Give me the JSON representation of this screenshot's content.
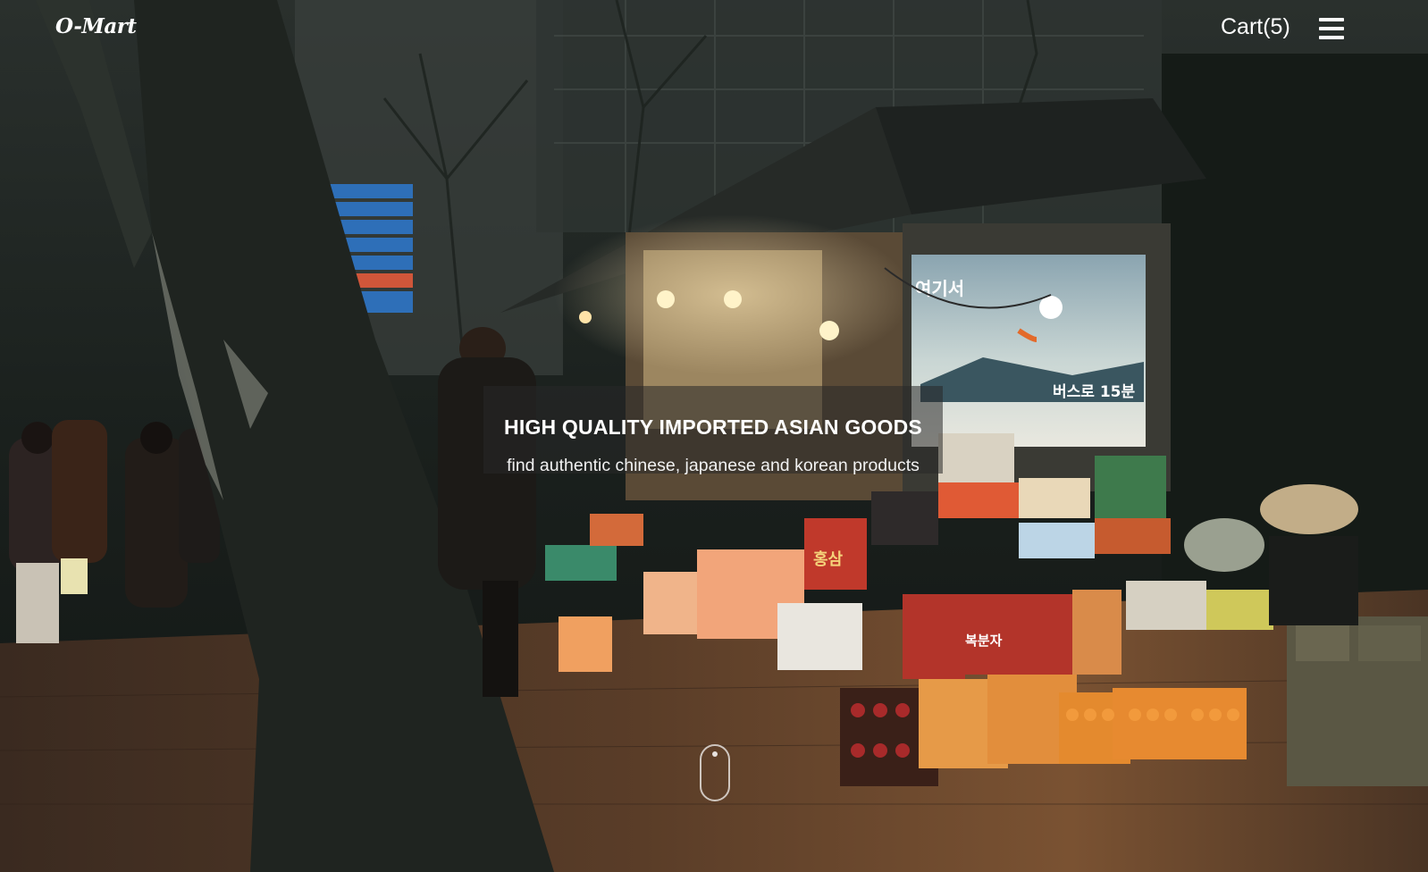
{
  "header": {
    "logo": "O-Mart",
    "cart_label": "Cart(5)",
    "menu_icon": "hamburger-menu-icon"
  },
  "hero": {
    "title": "HIGH QUALITY IMPORTED ASIAN GOODS",
    "subtitle": "find authentic chinese, japanese and korean products",
    "scroll_icon": "mouse-scroll-icon"
  },
  "background": {
    "kiosk_poster_headline": "여기서",
    "kiosk_poster_caption": "버스로 15분",
    "box_label_hongsam": "홍삼",
    "box_label_bokbunja": "복분자"
  },
  "colors": {
    "header_text": "#ffffff",
    "hero_band": "rgba(40,40,40,0.55)",
    "sky_dark": "#1a1f1c",
    "warm_light": "#f6d9a0"
  }
}
